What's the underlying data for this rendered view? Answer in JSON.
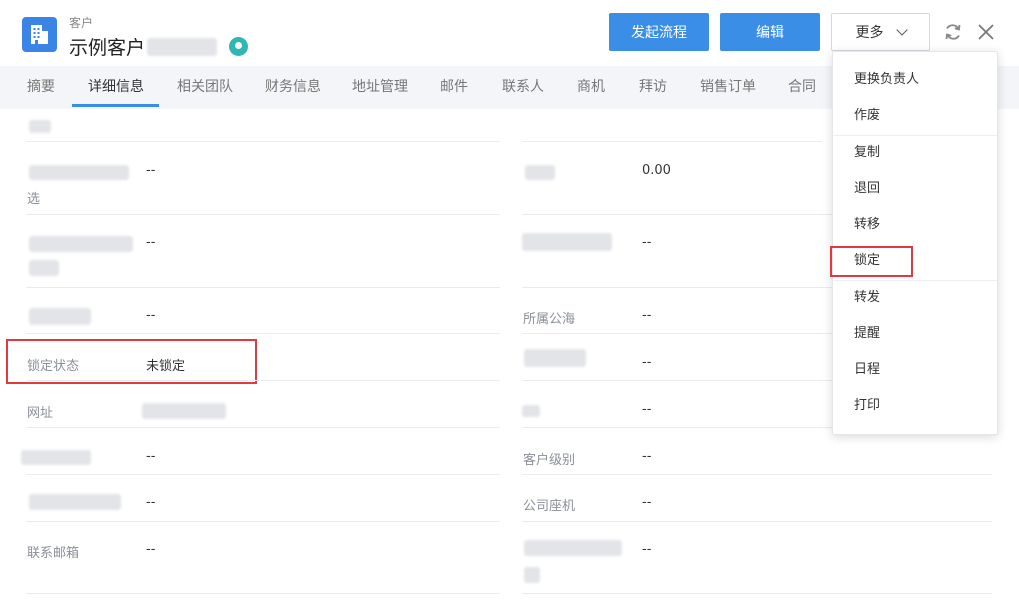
{
  "header": {
    "crumb": "客户",
    "title": "示例客户",
    "buttons": {
      "start_flow": "发起流程",
      "edit": "编辑",
      "more": "更多"
    }
  },
  "tabs": [
    {
      "label": "摘要",
      "active": false
    },
    {
      "label": "详细信息",
      "active": true
    },
    {
      "label": "相关团队",
      "active": false
    },
    {
      "label": "财务信息",
      "active": false
    },
    {
      "label": "地址管理",
      "active": false
    },
    {
      "label": "邮件",
      "active": false
    },
    {
      "label": "联系人",
      "active": false
    },
    {
      "label": "商机",
      "active": false
    },
    {
      "label": "拜访",
      "active": false
    },
    {
      "label": "销售订单",
      "active": false
    },
    {
      "label": "合同",
      "active": false
    }
  ],
  "fields": {
    "row1_left_label_suffix": "选",
    "row1_left_value": "--",
    "row1_right_value": "0.00",
    "row2_left_value": "--",
    "row2_right_value": "--",
    "row3_left_value": "--",
    "public_sea_label": "所属公海",
    "public_sea_value": "--",
    "lock_status_label": "锁定状态",
    "lock_status_value": "未锁定",
    "row5_right_value": "--",
    "website_label": "网址",
    "row6_right_value": "--",
    "row7_left_value": "--",
    "customer_level_label": "客户级别",
    "customer_level_value": "--",
    "row8_left_value": "--",
    "company_phone_label": "公司座机",
    "company_phone_value": "--",
    "contact_email_label": "联系邮箱",
    "contact_email_value": "--",
    "row9_right_value": "--"
  },
  "more_menu": [
    "更换负责人",
    "作废",
    "复制",
    "退回",
    "转移",
    "锁定",
    "转发",
    "提醒",
    "日程",
    "打印"
  ],
  "colors": {
    "primary": "#3a8ee6",
    "highlight": "#e0393e",
    "location": "#2fb8b3"
  }
}
